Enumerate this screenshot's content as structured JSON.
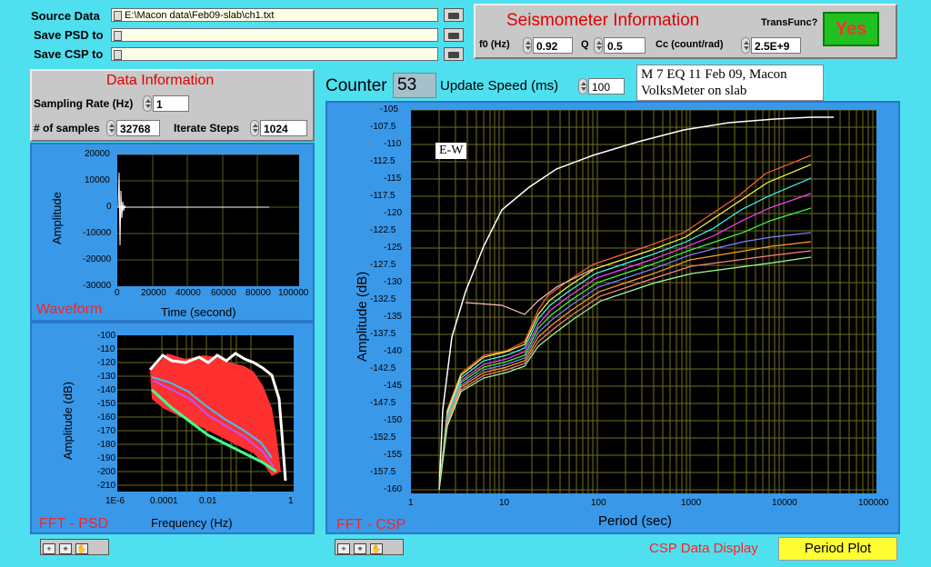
{
  "files": {
    "source_label": "Source Data",
    "source_value": "E:\\Macon data\\Feb09-slab\\ch1.txt",
    "psd_label": "Save PSD to",
    "psd_value": "",
    "csp_label": "Save CSP to",
    "csp_value": ""
  },
  "seismometer": {
    "title": "Seismometer Information",
    "transfunc_label": "TransFunc?",
    "transfunc_value": "Yes",
    "f0_label": "f0 (Hz)",
    "f0_value": "0.92",
    "q_label": "Q",
    "q_value": "0.5",
    "cc_label": "Cc (count/rad)",
    "cc_value": "2.5E+9"
  },
  "data_info": {
    "title": "Data Information",
    "rate_label": "Sampling Rate (Hz)",
    "rate_value": "1",
    "samples_label": "# of samples",
    "samples_value": "32768",
    "iter_label": "Iterate Steps",
    "iter_value": "1024"
  },
  "controls": {
    "counter_label": "Counter",
    "counter_value": "53",
    "speed_label": "Update Speed (ms)",
    "speed_value": "100",
    "note_line1": "M 7 EQ 11 Feb 09, Macon",
    "note_line2": "VolksMeter on slab"
  },
  "waveform": {
    "title": "Waveform",
    "xlabel": "Time (second)",
    "ylabel": "Amplitude",
    "yticks": [
      "20000",
      "10000",
      "0",
      "-10000",
      "-20000",
      "-30000"
    ],
    "xticks": [
      "0",
      "20000",
      "40000",
      "60000",
      "80000",
      "100000"
    ]
  },
  "psd": {
    "title": "FFT - PSD",
    "xlabel": "Frequency (Hz)",
    "ylabel": "Amplitude (dB)",
    "yticks": [
      "-100",
      "-110",
      "-120",
      "-130",
      "-140",
      "-150",
      "-160",
      "-170",
      "-180",
      "-190",
      "-200",
      "-210"
    ],
    "xticks": [
      "1E-6",
      "0.0001",
      "0.01",
      "1"
    ]
  },
  "csp": {
    "title": "FFT - CSP",
    "channel_label": "E-W",
    "xlabel": "Period (sec)",
    "ylabel": "Amplitude (dB)",
    "yticks": [
      "-105",
      "-107.5",
      "-110",
      "-112.5",
      "-115",
      "-117.5",
      "-120",
      "-122.5",
      "-125",
      "-127.5",
      "-130",
      "-132.5",
      "-135",
      "-137.5",
      "-140",
      "-142.5",
      "-145",
      "-147.5",
      "-150",
      "-152.5",
      "-155",
      "-157.5",
      "-160"
    ],
    "xticks": [
      "1",
      "10",
      "100",
      "1000",
      "10000",
      "100000"
    ],
    "display_label": "CSP Data Display",
    "display_value": "Period Plot"
  },
  "colors": {
    "background": "#4fe0f0",
    "graph_panel": "#3a98e8",
    "title_red": "#e00000",
    "yes_button": "#20c020",
    "yes_text": "#ff3030",
    "display_yellow": "#ffff33"
  }
}
